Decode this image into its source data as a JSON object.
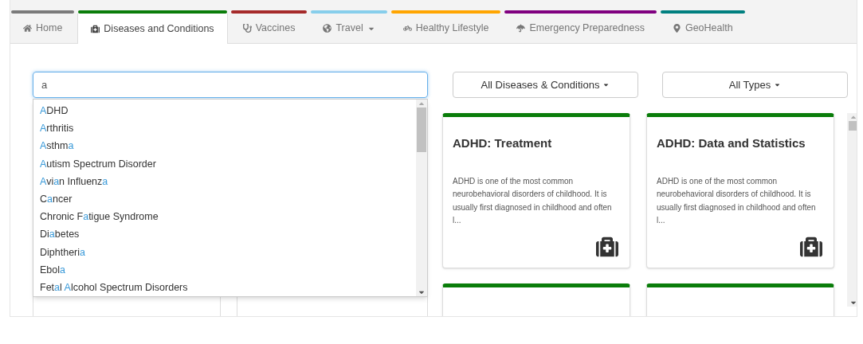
{
  "tabs": [
    {
      "label": "Home",
      "color": "#7a7a7a",
      "selected": false,
      "has_menu": false
    },
    {
      "label": "Diseases and Conditions",
      "color": "#0a7d0a",
      "selected": true,
      "has_menu": false
    },
    {
      "label": "Vaccines",
      "color": "#a52a2a",
      "selected": false,
      "has_menu": false
    },
    {
      "label": "Travel",
      "color": "#87ceeb",
      "selected": false,
      "has_menu": true
    },
    {
      "label": "Healthy Lifestyle",
      "color": "#ffa500",
      "selected": false,
      "has_menu": false
    },
    {
      "label": "Emergency Preparedness",
      "color": "#800080",
      "selected": false,
      "has_menu": false
    },
    {
      "label": "GeoHealth",
      "color": "#008080",
      "selected": false,
      "has_menu": false
    }
  ],
  "search": {
    "value": "a"
  },
  "suggestions": [
    [
      {
        "text": "A",
        "match": true
      },
      {
        "text": "DHD",
        "match": false
      }
    ],
    [
      {
        "text": "A",
        "match": true
      },
      {
        "text": "rthritis",
        "match": false
      }
    ],
    [
      {
        "text": "A",
        "match": true
      },
      {
        "text": "sthm",
        "match": false
      },
      {
        "text": "a",
        "match": true
      }
    ],
    [
      {
        "text": "A",
        "match": true
      },
      {
        "text": "utism Spectrum Disorder",
        "match": false
      }
    ],
    [
      {
        "text": "A",
        "match": true
      },
      {
        "text": "vi",
        "match": false
      },
      {
        "text": "a",
        "match": true
      },
      {
        "text": "n Influenz",
        "match": false
      },
      {
        "text": "a",
        "match": true
      }
    ],
    [
      {
        "text": "C",
        "match": false
      },
      {
        "text": "a",
        "match": true
      },
      {
        "text": "ncer",
        "match": false
      }
    ],
    [
      {
        "text": "Chronic F",
        "match": false
      },
      {
        "text": "a",
        "match": true
      },
      {
        "text": "tigue Syndrome",
        "match": false
      }
    ],
    [
      {
        "text": "Di",
        "match": false
      },
      {
        "text": "a",
        "match": true
      },
      {
        "text": "betes",
        "match": false
      }
    ],
    [
      {
        "text": "Diphtheri",
        "match": false
      },
      {
        "text": "a",
        "match": true
      }
    ],
    [
      {
        "text": "Ebol",
        "match": false
      },
      {
        "text": "a",
        "match": true
      }
    ],
    [
      {
        "text": "Fet",
        "match": false
      },
      {
        "text": "a",
        "match": true
      },
      {
        "text": "l ",
        "match": false
      },
      {
        "text": "A",
        "match": true
      },
      {
        "text": "lcohol Spectrum Disorders",
        "match": false
      }
    ]
  ],
  "filters": [
    "All Diseases & Conditions",
    "All Types"
  ],
  "cards": [
    {
      "kind": "article",
      "title": "ADHD: Treatment",
      "summary": "ADHD is one of the most common neurobehavioral disorders of childhood. It is usually first diagnosed in childhood and often l..."
    },
    {
      "kind": "article",
      "title": "ADHD: Data and Statistics",
      "summary": "ADHD is one of the most common neurobehavioral disorders of childhood. It is usually first diagnosed in childhood and often l..."
    },
    {
      "kind": "blank"
    },
    {
      "kind": "blank"
    }
  ]
}
